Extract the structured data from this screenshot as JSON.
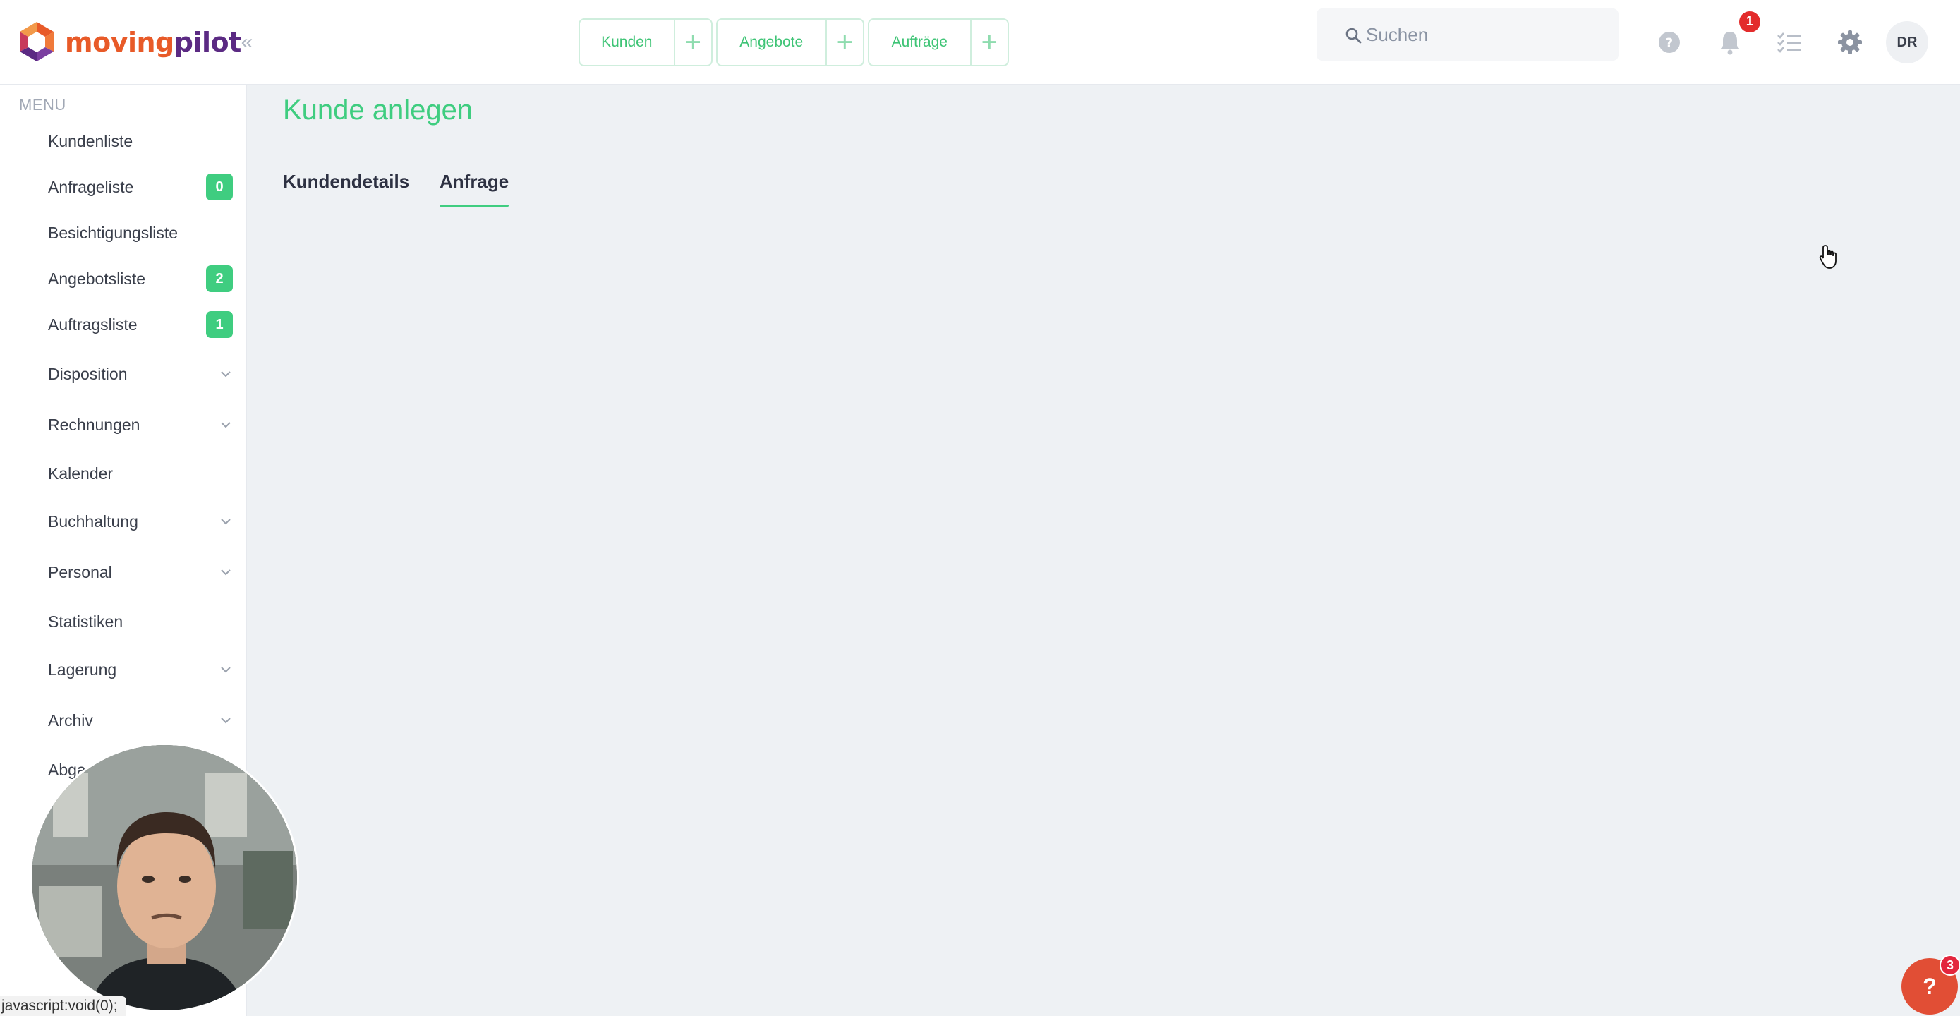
{
  "header": {
    "logo": {
      "part1": "moving",
      "part2": "pilot"
    },
    "quick_actions": [
      {
        "label": "Kunden",
        "add_icon": "plus-icon"
      },
      {
        "label": "Angebote",
        "add_icon": "plus-icon"
      },
      {
        "label": "Aufträge",
        "add_icon": "plus-icon"
      }
    ],
    "search": {
      "placeholder": "Suchen",
      "value": ""
    },
    "icons": [
      "help-icon",
      "bell-icon",
      "tasks-icon",
      "gear-icon"
    ],
    "notification_count": "1",
    "avatar_initials": "DR"
  },
  "sidebar": {
    "menu_title": "MENU",
    "items": [
      {
        "label": "Kundenliste"
      },
      {
        "label": "Anfrageliste",
        "badge": "0"
      },
      {
        "label": "Besichtigungsliste"
      },
      {
        "label": "Angebotsliste",
        "badge": "2"
      },
      {
        "label": "Auftragsliste",
        "badge": "1"
      },
      {
        "label": "Disposition",
        "expandable": true
      },
      {
        "label": "Rechnungen",
        "expandable": true
      },
      {
        "label": "Kalender"
      },
      {
        "label": "Buchhaltung",
        "expandable": true
      },
      {
        "label": "Personal",
        "expandable": true
      },
      {
        "label": "Statistiken"
      },
      {
        "label": "Lagerung",
        "expandable": true
      },
      {
        "label": "Archiv",
        "expandable": true
      },
      {
        "label": "Abga"
      }
    ]
  },
  "main": {
    "title": "Kunde anlegen",
    "tabs": [
      {
        "label": "Kundendetails",
        "active": false
      },
      {
        "label": "Anfrage",
        "active": true
      }
    ]
  },
  "status_bar": {
    "url": "javascript:void(0);"
  },
  "help_widget": {
    "label": "?",
    "badge": "3"
  },
  "colors": {
    "accent": "#3fcd80",
    "logo_orange": "#e85a28",
    "logo_purple": "#5b2a83",
    "alert": "#e32b2b"
  }
}
